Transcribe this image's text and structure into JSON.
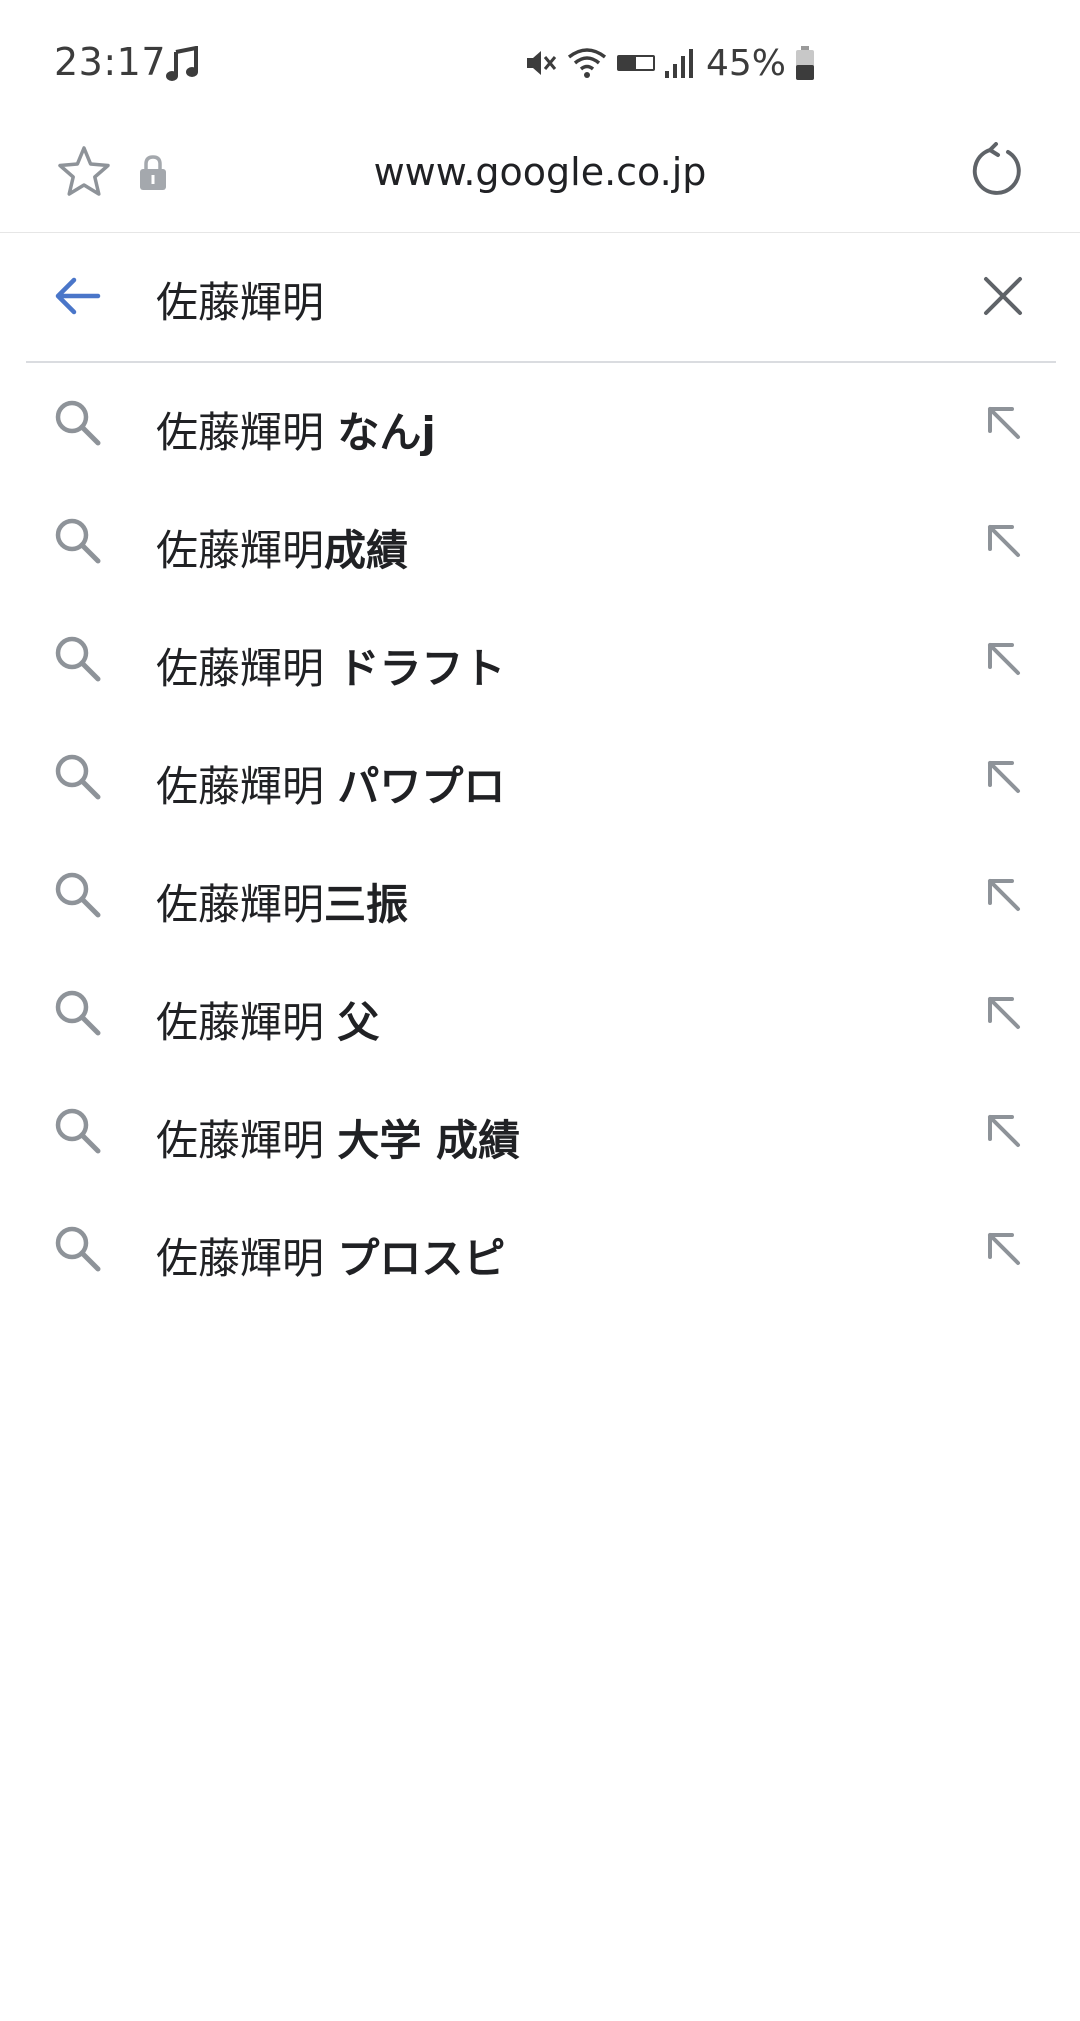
{
  "status_bar": {
    "time": "23:17",
    "battery": "45%",
    "icons": [
      "music-note-icon",
      "mute-icon",
      "wifi-icon",
      "volte-icon",
      "signal-icon",
      "battery-icon"
    ]
  },
  "url_bar": {
    "url": "www.google.co.jp",
    "icons": [
      "star-icon",
      "lock-icon",
      "reload-icon"
    ]
  },
  "search": {
    "query": "佐藤輝明",
    "icons": [
      "back-arrow-icon",
      "clear-icon"
    ]
  },
  "suggestions": [
    {
      "prefix": "佐藤輝明 ",
      "suffix": "なんj"
    },
    {
      "prefix": "佐藤輝明",
      "suffix": "成績"
    },
    {
      "prefix": "佐藤輝明 ",
      "suffix": "ドラフト"
    },
    {
      "prefix": "佐藤輝明 ",
      "suffix": "パワプロ"
    },
    {
      "prefix": "佐藤輝明",
      "suffix": "三振"
    },
    {
      "prefix": "佐藤輝明 ",
      "suffix": "父"
    },
    {
      "prefix": "佐藤輝明 ",
      "suffix": "大学 成績"
    },
    {
      "prefix": "佐藤輝明 ",
      "suffix": "プロスピ"
    }
  ],
  "colors": {
    "accent": "#4a76c9",
    "icon_gray": "#8e9399",
    "text": "#202124"
  }
}
